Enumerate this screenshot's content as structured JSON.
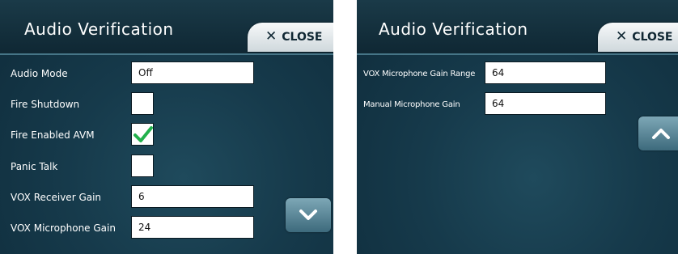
{
  "left_screen": {
    "title": "Audio Verification",
    "close_label": "CLOSE",
    "rows": [
      {
        "label": "Audio Mode",
        "value": "Off"
      },
      {
        "label": "Fire Shutdown",
        "checked": false
      },
      {
        "label": "Fire Enabled AVM",
        "checked": true
      },
      {
        "label": "Panic Talk",
        "checked": false
      },
      {
        "label": "VOX Receiver Gain",
        "value": "6"
      },
      {
        "label": "VOX Microphone Gain",
        "value": "24"
      }
    ],
    "scroll_icon": "chevron-down-icon"
  },
  "right_screen": {
    "title": "Audio Verification",
    "close_label": "CLOSE",
    "rows": [
      {
        "label": "VOX Microphone Gain Range",
        "value": "64"
      },
      {
        "label": "Manual Microphone Gain",
        "value": "64"
      }
    ],
    "scroll_icon": "chevron-up-icon"
  },
  "colors": {
    "background": "#163a4b",
    "checkmark": "#22b14c",
    "button": "#5d8a9b"
  }
}
